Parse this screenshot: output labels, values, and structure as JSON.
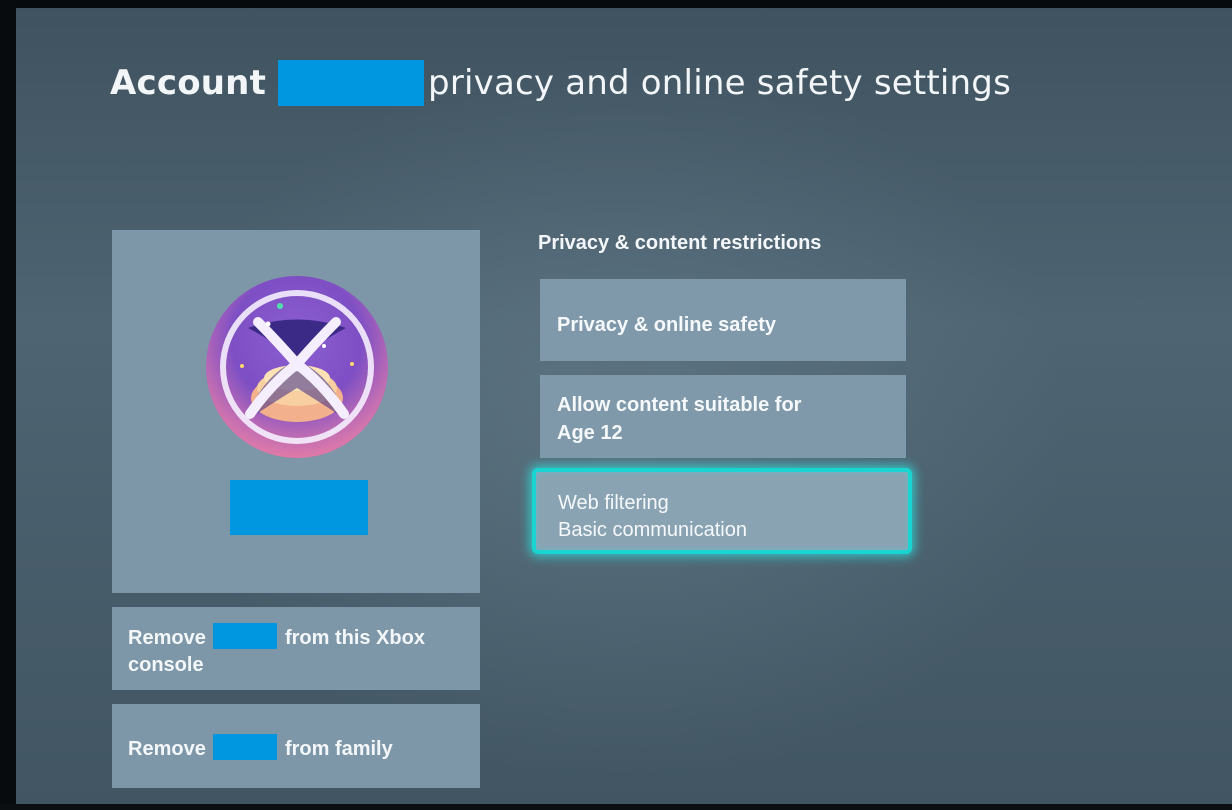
{
  "header": {
    "title_prefix": "Account",
    "title_suffix": "privacy and online safety settings"
  },
  "profile": {
    "actions": {
      "remove_console_part1": "Remove",
      "remove_console_part2": "from this Xbox",
      "remove_console_line2": "console",
      "remove_family_part1": "Remove",
      "remove_family_part2": "from family"
    }
  },
  "settings": {
    "section_heading": "Privacy & content restrictions",
    "tiles": [
      {
        "title": "Privacy & online safety"
      },
      {
        "title": "Allow content suitable for",
        "subtitle": "Age 12"
      },
      {
        "title": "Web filtering",
        "subtitle": "Basic communication",
        "focused": true
      }
    ]
  },
  "colors": {
    "redaction": "#0096e0",
    "focus_ring": "#19d4d0",
    "tile_background": "#7f99aa",
    "screen_background": "#4e6472"
  },
  "icons": {
    "avatar": "xbox-gamerpic-icon"
  }
}
